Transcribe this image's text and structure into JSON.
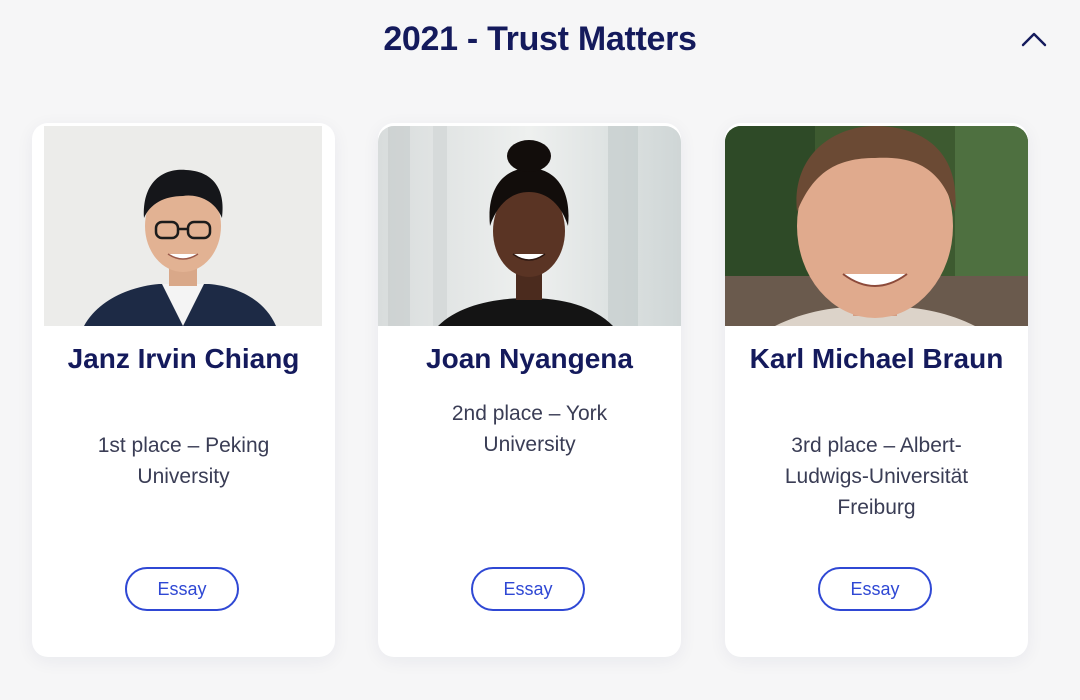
{
  "section": {
    "title": "2021 - Trust Matters",
    "collapse_icon": "chevron-up-icon"
  },
  "winners": [
    {
      "name": "Janz Irvin Chiang",
      "place": "1st place – Peking University",
      "button_label": "Essay"
    },
    {
      "name": "Joan Nyangena",
      "place": "2nd place – York University",
      "button_label": "Essay"
    },
    {
      "name": "Karl Michael Braun",
      "place": "3rd place – Albert-Ludwigs-Universität Freiburg",
      "button_label": "Essay"
    }
  ],
  "colors": {
    "title": "#141a5c",
    "accent": "#2f48d4",
    "background": "#f6f6f7",
    "card": "#ffffff"
  }
}
